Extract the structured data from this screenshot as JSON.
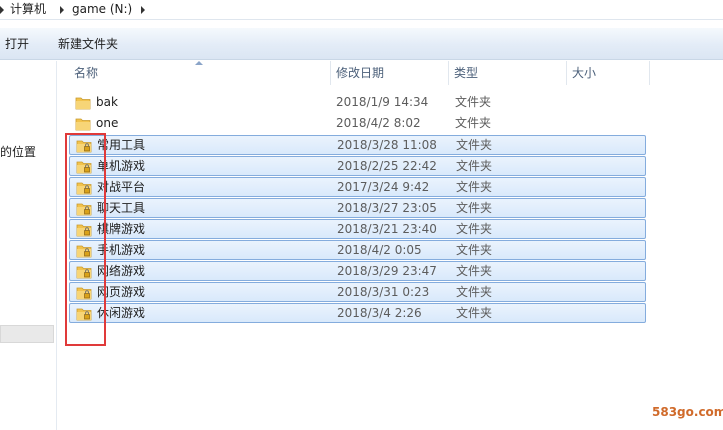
{
  "address": {
    "crumbs": [
      "计算机",
      "game (N:)"
    ]
  },
  "toolbar": {
    "open_label": "打开",
    "new_folder_label": "新建文件夹"
  },
  "nav": {
    "partial_label": "的位置"
  },
  "columns": {
    "name": "名称",
    "date": "修改日期",
    "type": "类型",
    "size": "大小",
    "sort_column": "name"
  },
  "files": [
    {
      "name": "bak",
      "date": "2018/1/9 14:34",
      "type": "文件夹",
      "locked": false,
      "selected": false
    },
    {
      "name": "one",
      "date": "2018/4/2 8:02",
      "type": "文件夹",
      "locked": false,
      "selected": false
    },
    {
      "name": "常用工具",
      "date": "2018/3/28 11:08",
      "type": "文件夹",
      "locked": true,
      "selected": true
    },
    {
      "name": "单机游戏",
      "date": "2018/2/25 22:42",
      "type": "文件夹",
      "locked": true,
      "selected": true
    },
    {
      "name": "对战平台",
      "date": "2017/3/24 9:42",
      "type": "文件夹",
      "locked": true,
      "selected": true
    },
    {
      "name": "聊天工具",
      "date": "2018/3/27 23:05",
      "type": "文件夹",
      "locked": true,
      "selected": true
    },
    {
      "name": "棋牌游戏",
      "date": "2018/3/21 23:40",
      "type": "文件夹",
      "locked": true,
      "selected": true
    },
    {
      "name": "手机游戏",
      "date": "2018/4/2 0:05",
      "type": "文件夹",
      "locked": true,
      "selected": true
    },
    {
      "name": "网络游戏",
      "date": "2018/3/29 23:47",
      "type": "文件夹",
      "locked": true,
      "selected": true
    },
    {
      "name": "网页游戏",
      "date": "2018/3/31 0:23",
      "type": "文件夹",
      "locked": true,
      "selected": true
    },
    {
      "name": "休闲游戏",
      "date": "2018/3/4 2:26",
      "type": "文件夹",
      "locked": true,
      "selected": true
    }
  ],
  "colors": {
    "selection": "#d9e9fb",
    "selection_border": "#84acdd",
    "folder": "#f2c34d",
    "highlight": "#e03a3a"
  },
  "watermark": "583go.com"
}
